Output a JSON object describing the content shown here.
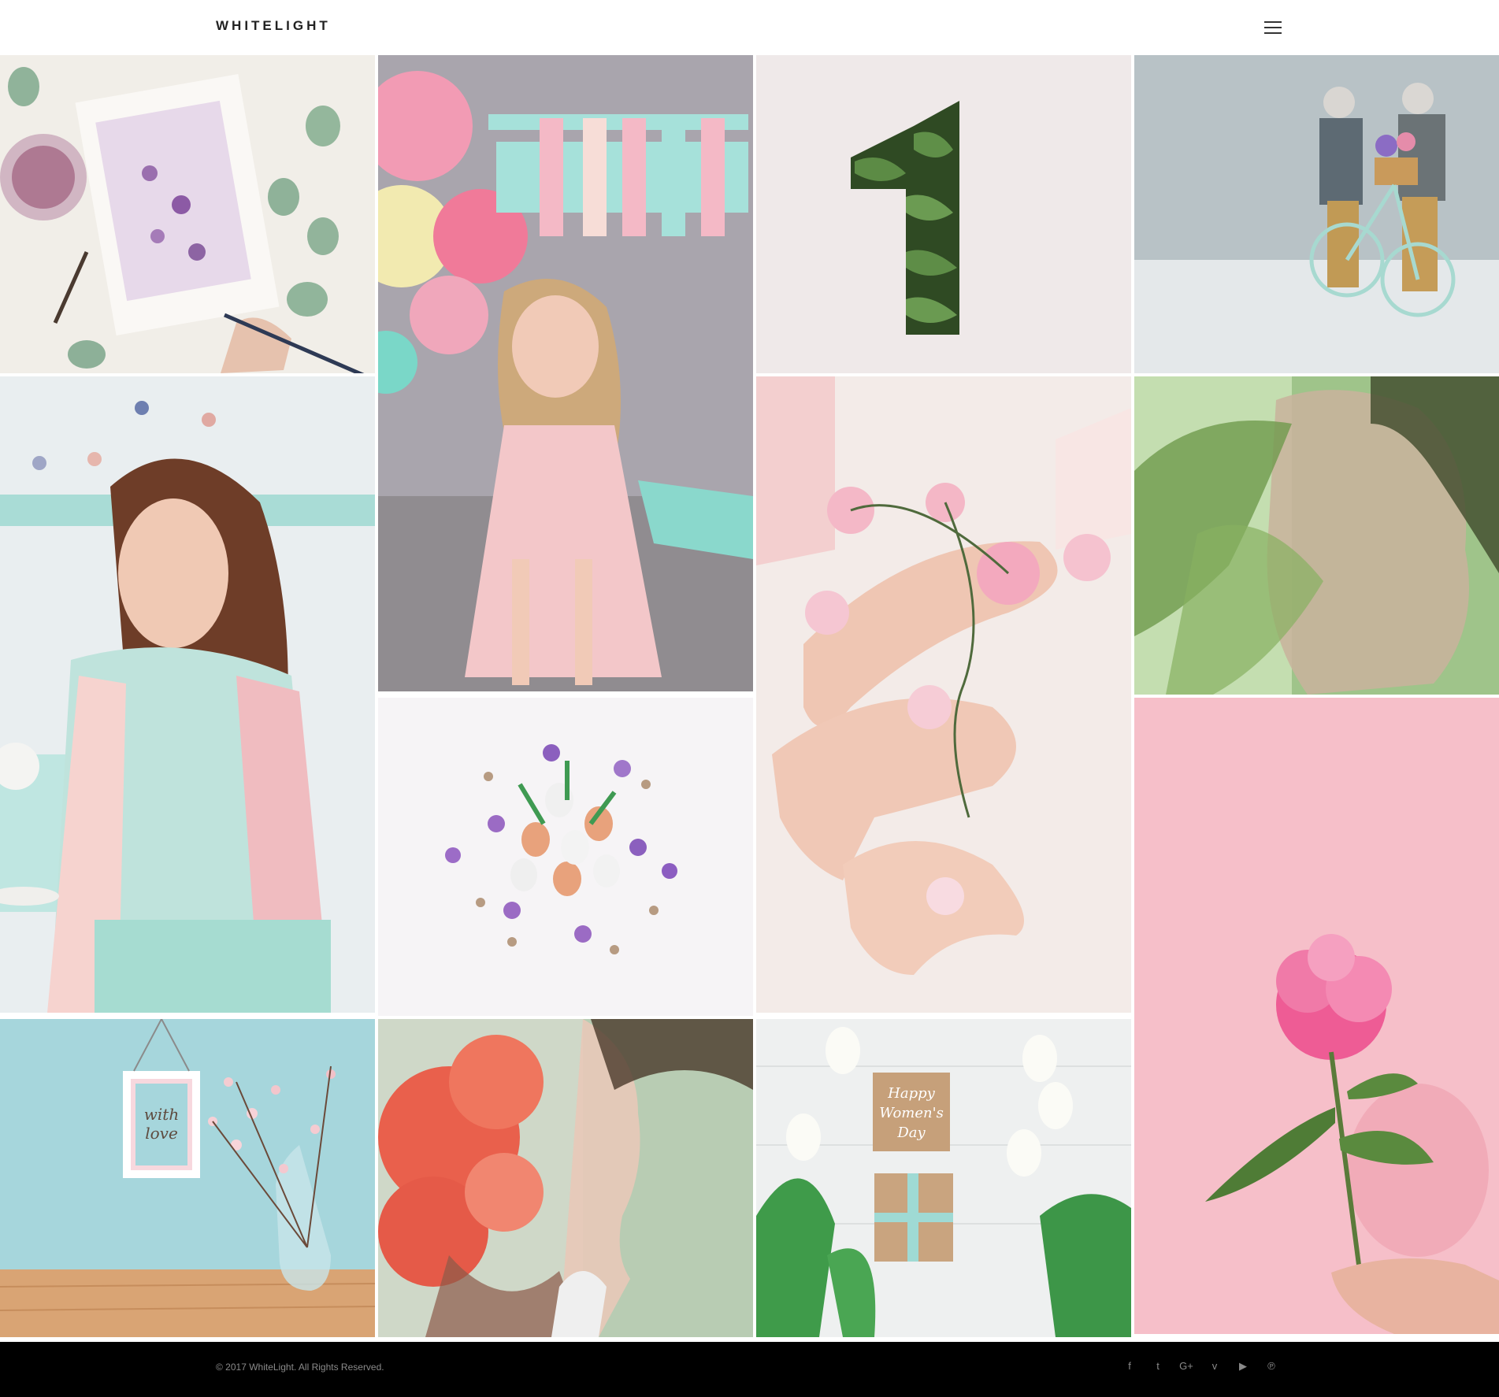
{
  "header": {
    "logo": "WHITELIGHT",
    "menu_icon": "hamburger-menu-icon"
  },
  "gallery": {
    "items": [
      {
        "name": "watercolor-painting-photo",
        "icon": "image"
      },
      {
        "name": "girl-with-balloons-photo",
        "icon": "image"
      },
      {
        "name": "number-one-leaves-photo",
        "icon": "image"
      },
      {
        "name": "senior-couple-bicycle-photo",
        "icon": "image"
      },
      {
        "name": "woman-in-cafe-photo",
        "icon": "image"
      },
      {
        "name": "hands-with-flowers-photo",
        "icon": "image"
      },
      {
        "name": "double-exposure-forest-photo",
        "icon": "image"
      },
      {
        "name": "easter-eggs-flowers-photo",
        "icon": "image"
      },
      {
        "name": "peony-on-pink-photo",
        "icon": "image"
      },
      {
        "name": "with-love-frame-photo",
        "icon": "image"
      },
      {
        "name": "double-exposure-flower-photo",
        "icon": "image"
      },
      {
        "name": "womens-day-gift-photo",
        "icon": "image"
      }
    ],
    "texts": {
      "frame_line1": "with",
      "frame_line2": "love",
      "card_line1": "Happy",
      "card_line2": "Women's",
      "card_line3": "Day"
    }
  },
  "footer": {
    "copyright": "© 2017 WhiteLight. All Rights Reserved.",
    "social": [
      {
        "name": "facebook-icon",
        "glyph": "f"
      },
      {
        "name": "twitter-icon",
        "glyph": "t"
      },
      {
        "name": "google-plus-icon",
        "glyph": "G+"
      },
      {
        "name": "vimeo-icon",
        "glyph": "v"
      },
      {
        "name": "youtube-icon",
        "glyph": "▶"
      },
      {
        "name": "pinterest-icon",
        "glyph": "℗"
      }
    ]
  },
  "colors": {
    "footer_bg": "#000000",
    "accent_pink": "#f4b8c6",
    "accent_mint": "#bfe3dc"
  }
}
